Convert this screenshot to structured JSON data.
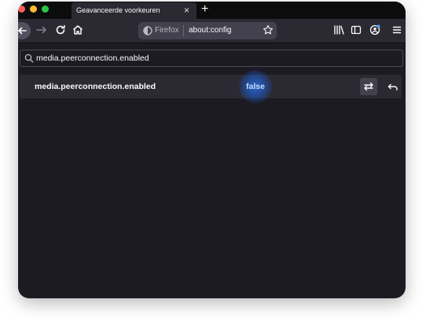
{
  "tab": {
    "title": "Geavanceerde voorkeuren",
    "close_glyph": "×"
  },
  "toolbar": {
    "new_tab_glyph": "+",
    "url_identity_label": "Firefox",
    "url_text": "about:config"
  },
  "search": {
    "value": "media.peerconnection.enabled"
  },
  "preference": {
    "name": "media.peerconnection.enabled",
    "value": "false"
  },
  "colors": {
    "background": "#1c1b22",
    "toolbar": "#2b2a33",
    "tabstrip": "#0c0c0d",
    "highlight": "#1f5fd0"
  },
  "icons": [
    "back-icon",
    "forward-icon",
    "reload-icon",
    "home-icon",
    "firefox-icon",
    "bookmark-star-icon",
    "library-icon",
    "sidebar-icon",
    "account-icon",
    "menu-icon",
    "search-icon",
    "toggle-icon",
    "reset-icon"
  ]
}
